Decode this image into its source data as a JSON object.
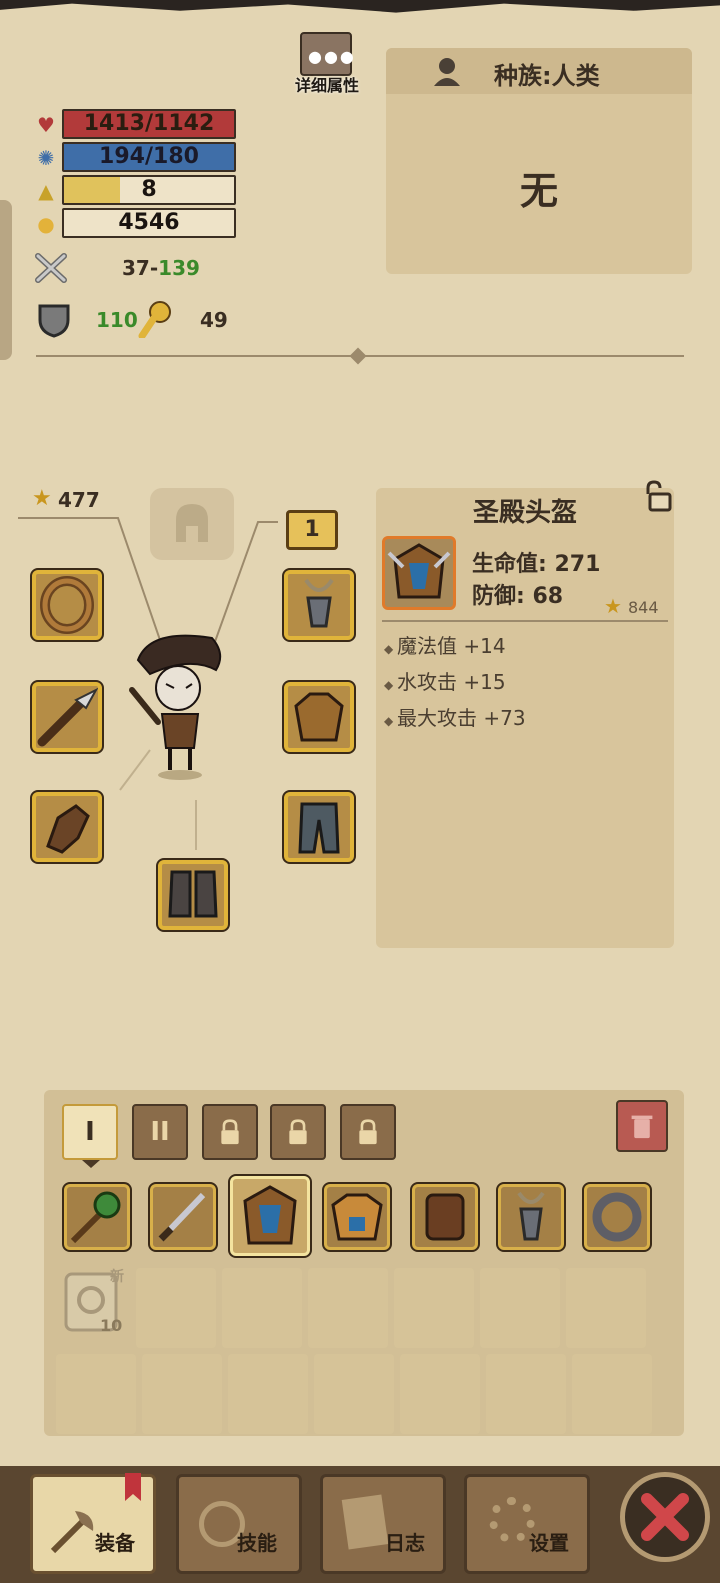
{
  "header": {
    "detail_label": "详细属性"
  },
  "stats": {
    "hp": "1413/1142",
    "mp": "194/180",
    "level": "8",
    "gold": "4546",
    "atk_min": "37",
    "atk_dash": "-",
    "atk_max": "139",
    "defense": "110",
    "luck": "49",
    "hp_fill": 1.0,
    "mp_fill": 1.0,
    "exp_fill": 0.33
  },
  "race": {
    "label": "种族:人类",
    "value": "无"
  },
  "equipment": {
    "score": "477",
    "slot_badge": "1"
  },
  "item_detail": {
    "name": "圣殿头盔",
    "hp_label": "生命值: 271",
    "def_label": "防御: 68",
    "score": "844",
    "affixes": [
      "魔法值 +14",
      "水攻击 +15",
      "最大攻击 +73"
    ]
  },
  "inventory": {
    "tabs": [
      "I",
      "II"
    ],
    "new_badge": "新",
    "new_count": "10"
  },
  "nav": {
    "equip": "装备",
    "skills": "技能",
    "log": "日志",
    "settings": "设置"
  },
  "colors": {
    "hp": "#b23a3a",
    "mp": "#3f6ea8",
    "exp": "#e0c25c",
    "accent_green": "#3a8a2a"
  }
}
